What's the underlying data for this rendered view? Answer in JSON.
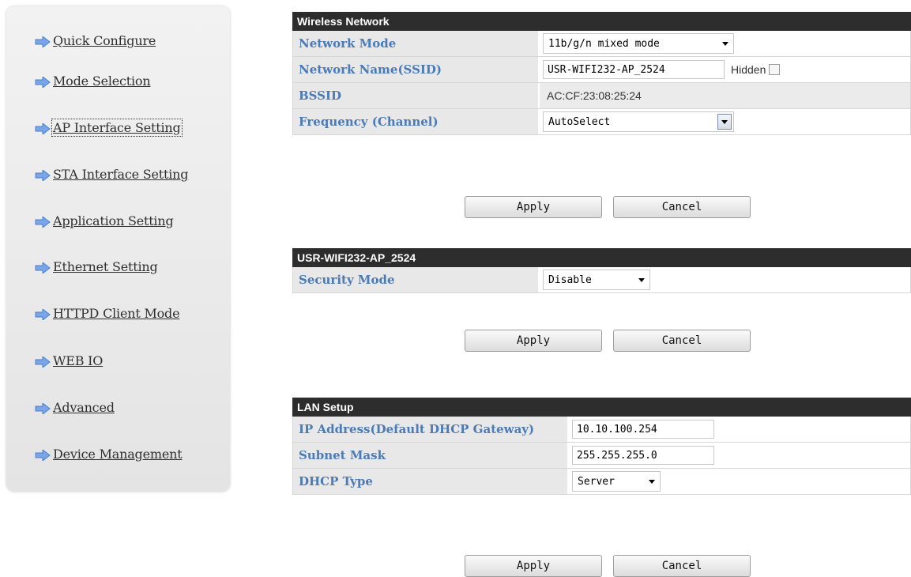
{
  "sidebar": {
    "items": [
      {
        "label": "Quick Configure"
      },
      {
        "label": "Mode Selection"
      },
      {
        "label": "AP Interface Setting"
      },
      {
        "label": "STA Interface Setting"
      },
      {
        "label": "Application Setting"
      },
      {
        "label": "Ethernet Setting"
      },
      {
        "label": "HTTPD Client Mode"
      },
      {
        "label": "WEB IO"
      },
      {
        "label": "Advanced"
      },
      {
        "label": "Device Management"
      }
    ]
  },
  "wireless": {
    "title": "Wireless Network",
    "network_mode_label": "Network Mode",
    "network_mode_value": "11b/g/n mixed mode",
    "ssid_label": "Network Name(SSID)",
    "ssid_value": "USR-WIFI232-AP_2524",
    "hidden_label": "Hidden",
    "bssid_label": "BSSID",
    "bssid_value": "AC:CF:23:08:25:24",
    "frequency_label": "Frequency (Channel)",
    "frequency_value": "AutoSelect",
    "apply": "Apply",
    "cancel": "Cancel"
  },
  "security": {
    "title": "USR-WIFI232-AP_2524",
    "mode_label": "Security Mode",
    "mode_value": "Disable",
    "apply": "Apply",
    "cancel": "Cancel"
  },
  "lan": {
    "title": "LAN Setup",
    "ip_label": "IP Address(Default DHCP Gateway)",
    "ip_value": "10.10.100.254",
    "subnet_label": "Subnet Mask",
    "subnet_value": "255.255.255.0",
    "dhcp_label": "DHCP Type",
    "dhcp_value": "Server",
    "apply": "Apply",
    "cancel": "Cancel"
  },
  "colors": {
    "header_bg": "#2d2d2d",
    "label_text": "#4a7ab8",
    "label_bg": "#e8e8e8",
    "nav_arrow": "#6b9be0"
  }
}
